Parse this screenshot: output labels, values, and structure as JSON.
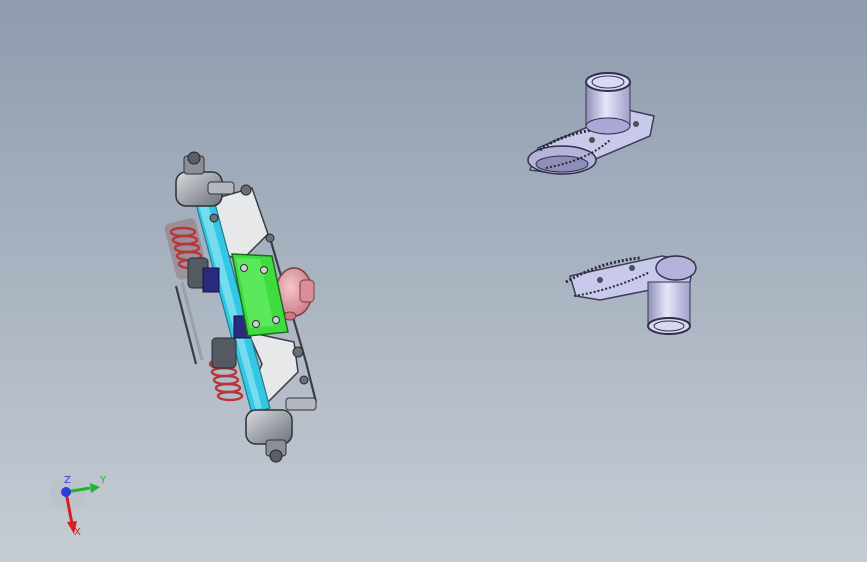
{
  "viewport": {
    "background_top": "#8e9cae",
    "background_bottom": "#c5ccd4"
  },
  "colors": {
    "axle_cyan": "#35c6e3",
    "housing_green": "#3fdc3f",
    "diff_pink": "#e39aa3",
    "spring_red": "#b8363a",
    "mount_navy": "#2c2a7e",
    "metal_grey": "#a9adb4",
    "metal_dark": "#4b4f57",
    "hub_lavender": "#c9c9ec",
    "hub_lavender_dark": "#8e8eb8"
  },
  "triad": {
    "x_label": "X",
    "y_label": "Y",
    "z_label": "Z",
    "x_color": "#d81f1f",
    "y_color": "#1fb52b",
    "z_color": "#2b3fd8"
  },
  "parts": [
    "rear-axle-assembly",
    "wheel-hub-upper",
    "wheel-hub-lower"
  ]
}
